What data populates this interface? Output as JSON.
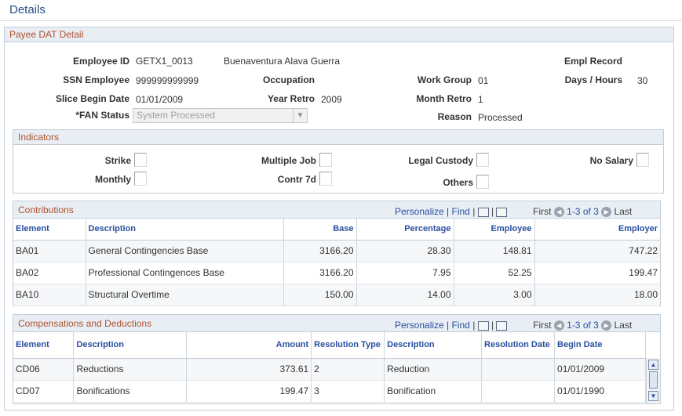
{
  "page": {
    "title": "Details"
  },
  "detail": {
    "header": "Payee DAT Detail",
    "employee_id_label": "Employee ID",
    "employee_id": "GETX1_0013",
    "employee_name": "Buenaventura Alava Guerra",
    "empl_record_label": "Empl Record",
    "ssn_label": "SSN Employee",
    "ssn": "999999999999",
    "occupation_label": "Occupation",
    "work_group_label": "Work Group",
    "work_group": "01",
    "days_hours_label": "Days / Hours",
    "days_hours": "30",
    "slice_begin_label": "Slice Begin Date",
    "slice_begin": "01/01/2009",
    "year_retro_label": "Year Retro",
    "year_retro": "2009",
    "month_retro_label": "Month Retro",
    "month_retro": "1",
    "fan_status_label": "*FAN Status",
    "fan_status": "System Processed",
    "reason_label": "Reason",
    "reason": "Processed"
  },
  "indicators": {
    "header": "Indicators",
    "strike": "Strike",
    "multiple_job": "Multiple Job",
    "legal_custody": "Legal Custody",
    "no_salary": "No Salary",
    "monthly": "Monthly",
    "contr7d": "Contr 7d",
    "others": "Others"
  },
  "contributions": {
    "header": "Contributions",
    "personalize": "Personalize",
    "find": "Find",
    "first": "First",
    "range": "1-3 of 3",
    "last": "Last",
    "columns": [
      "Element",
      "Description",
      "Base",
      "Percentage",
      "Employee",
      "Employer"
    ],
    "rows": [
      [
        "BA01",
        "General Contingencies Base",
        "3166.20",
        "28.30",
        "148.81",
        "747.22"
      ],
      [
        "BA02",
        "Professional Contingences Base",
        "3166.20",
        "7.95",
        "52.25",
        "199.47"
      ],
      [
        "BA10",
        "Structural Overtime",
        "150.00",
        "14.00",
        "3.00",
        "18.00"
      ]
    ]
  },
  "compensations": {
    "header": "Compensations and Deductions",
    "personalize": "Personalize",
    "find": "Find",
    "first": "First",
    "range": "1-3 of 3",
    "last": "Last",
    "columns": [
      "Element",
      "Description",
      "Amount",
      "Resolution Type",
      "Description",
      "Resolution Date",
      "Begin Date"
    ],
    "rows": [
      [
        "CD06",
        "Reductions",
        "373.61",
        "2",
        "Reduction",
        "",
        "01/01/2009"
      ],
      [
        "CD07",
        "Bonifications",
        "199.47",
        "3",
        "Bonification",
        "",
        "01/01/1990"
      ]
    ]
  }
}
